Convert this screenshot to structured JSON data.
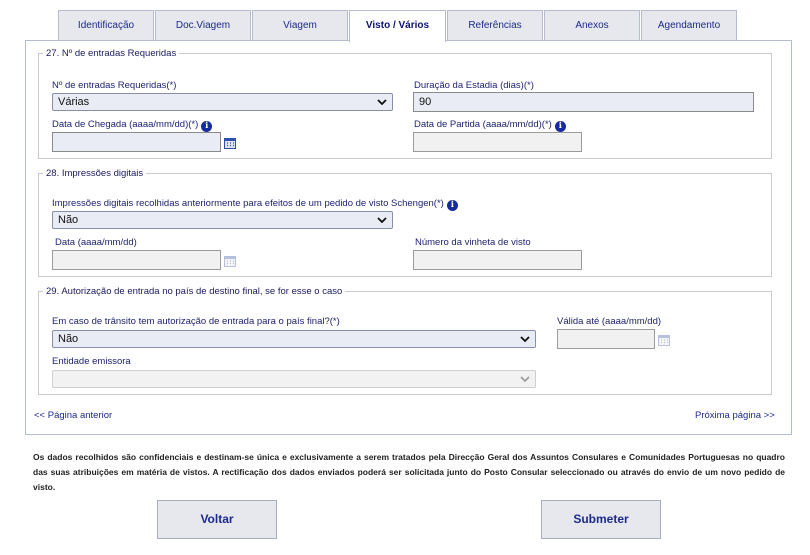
{
  "tabs": [
    {
      "label": "Identificação"
    },
    {
      "label": "Doc.Viagem"
    },
    {
      "label": "Viagem"
    },
    {
      "label": "Visto / Vários"
    },
    {
      "label": "Referências"
    },
    {
      "label": "Anexos"
    },
    {
      "label": "Agendamento"
    }
  ],
  "active_tab": "Visto / Vários",
  "section27": {
    "legend": "27. Nº de entradas Requeridas",
    "entries_label": "Nº de entradas Requeridas(*)",
    "entries_value": "Várias",
    "duration_label": "Duração da Estadia (dias)(*)",
    "duration_value": "90",
    "arrival_label": "Data de Chegada (aaaa/mm/dd)(*)",
    "arrival_value": "",
    "departure_label": "Data de Partida (aaaa/mm/dd)(*)",
    "departure_value": ""
  },
  "section28": {
    "legend": "28. Impressões digitais",
    "fingerprints_label": "Impressões digitais recolhidas anteriormente para efeitos de um pedido de visto Schengen(*)",
    "fingerprints_value": "Não",
    "date_label": "Data (aaaa/mm/dd)",
    "date_value": "",
    "sticker_label": "Número da vinheta de visto",
    "sticker_value": ""
  },
  "section29": {
    "legend": "29. Autorização de entrada no país de destino final, se for esse o caso",
    "transit_label": "Em caso de trânsito tem autorização de entrada para o país final?(*)",
    "transit_value": "Não",
    "valid_label": "Válida até (aaaa/mm/dd)",
    "valid_value": "",
    "issuer_label": "Entidade emissora",
    "issuer_value": ""
  },
  "nav": {
    "prev": "<< Página anterior",
    "next": "Próxima página >>"
  },
  "notice": "Os dados recolhidos são confidenciais e destinam-se única e exclusivamente a serem tratados pela Direcção Geral dos Assuntos Consulares e Comunidades Portuguesas no quadro das suas atribuições em matéria de vistos. A rectificação dos dados enviados poderá ser solicitada junto do Posto Consular seleccionado ou através do envio de um novo pedido de visto.",
  "buttons": {
    "back": "Voltar",
    "submit": "Submeter"
  },
  "icons": {
    "info": "info-icon",
    "calendar": "calendar-icon",
    "dropdown": "chevron-down-icon"
  },
  "colors": {
    "accent": "#1d2a8c",
    "tab_bg": "#e6e8ee",
    "field_bg": "#e9ebf5"
  }
}
